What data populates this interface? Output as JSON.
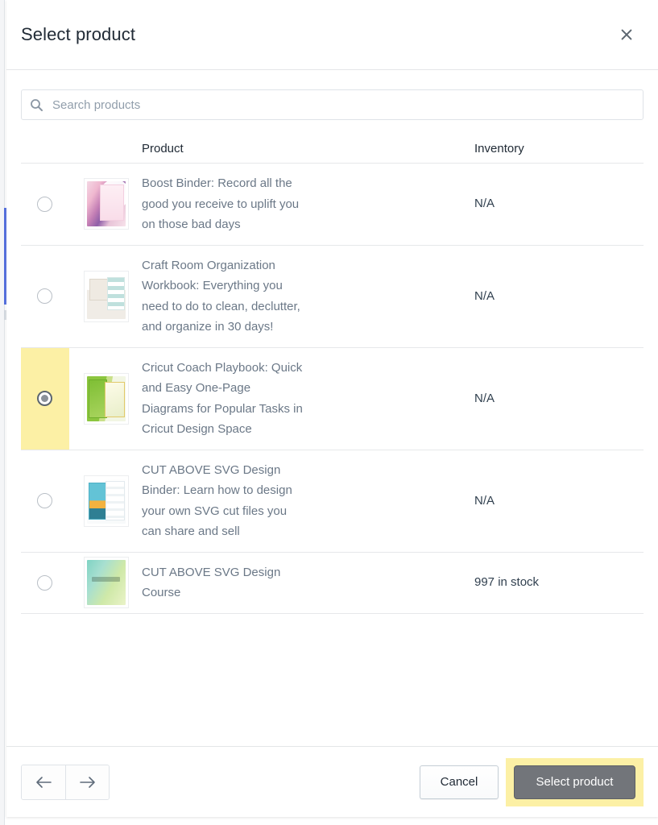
{
  "modal": {
    "title": "Select product",
    "close_icon": "close-icon"
  },
  "search": {
    "icon": "search-icon",
    "placeholder": "Search products",
    "value": ""
  },
  "table": {
    "headers": {
      "product": "Product",
      "inventory": "Inventory"
    },
    "rows": [
      {
        "selected": false,
        "thumb": "boost-binder-thumbnail",
        "name": "Boost Binder: Record all the good you receive to uplift you on those bad days",
        "inventory": "N/A"
      },
      {
        "selected": false,
        "thumb": "craft-room-organization-thumbnail",
        "name": "Craft Room Organization Workbook: Everything you need to do to clean, declutter, and organize in 30 days!",
        "inventory": "N/A"
      },
      {
        "selected": true,
        "thumb": "cricut-coach-playbook-thumbnail",
        "name": "Cricut Coach Playbook: Quick and Easy One-Page Diagrams for Popular Tasks in Cricut Design Space",
        "inventory": "N/A"
      },
      {
        "selected": false,
        "thumb": "cut-above-svg-design-binder-thumbnail",
        "name": "CUT ABOVE SVG Design Binder: Learn how to design your own SVG cut files you can share and sell",
        "inventory": "N/A"
      },
      {
        "selected": false,
        "thumb": "cut-above-svg-design-course-thumbnail",
        "name": "CUT ABOVE SVG Design Course",
        "inventory": "997 in stock"
      }
    ]
  },
  "footer": {
    "previous_icon": "arrow-left-icon",
    "next_icon": "arrow-right-icon",
    "cancel_label": "Cancel",
    "select_label": "Select product"
  },
  "colors": {
    "highlight": "#fcf0a5",
    "primary_button": "#72757a",
    "text_muted": "#6b7887",
    "text_dark": "#212b36",
    "border": "#dfe3e8"
  }
}
